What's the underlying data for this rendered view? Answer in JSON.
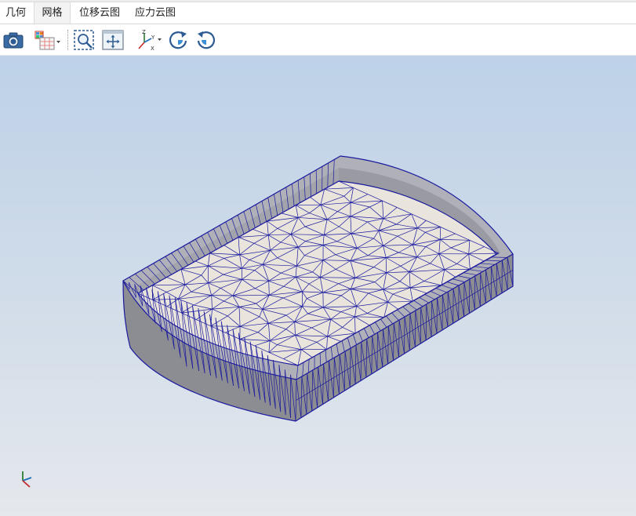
{
  "tabs": [
    {
      "label": "几何",
      "active": false
    },
    {
      "label": "网格",
      "active": true
    },
    {
      "label": "位移云图",
      "active": false
    },
    {
      "label": "应力云图",
      "active": false
    }
  ],
  "toolbar": {
    "axis_icon_letters": {
      "z": "Z",
      "y": "Y",
      "x": "X"
    }
  },
  "colors": {
    "mesh_line": "#1a1a9e",
    "floor_fill": "#e9e4dc",
    "wall_side": "#8c8c93",
    "wall_top": "#b0b0b8",
    "bg_top": "#bdd1e8",
    "bg_bottom": "#e5e8ed",
    "accent_blue": "#1e6fb8"
  }
}
